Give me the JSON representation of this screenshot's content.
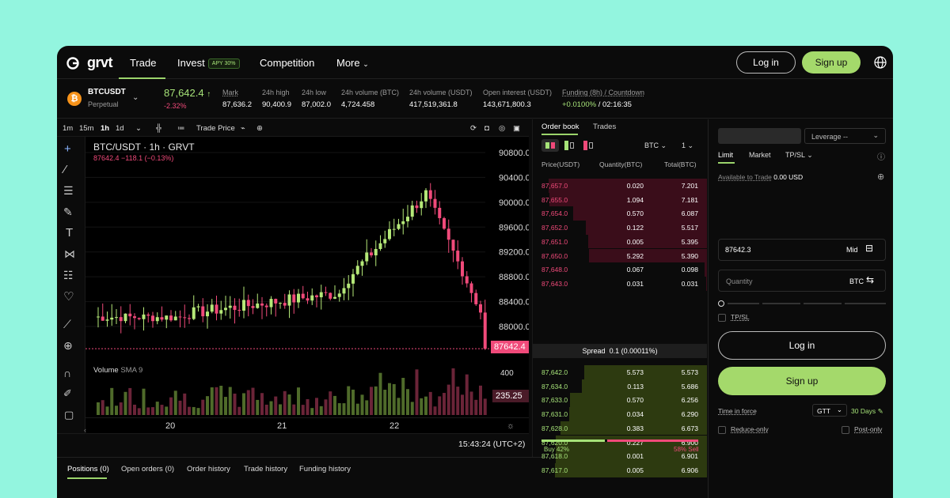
{
  "nav": {
    "logo_text": "grvt",
    "items": [
      {
        "label": "Trade"
      },
      {
        "label": "Invest"
      },
      {
        "label": "Competition"
      },
      {
        "label": "More"
      }
    ],
    "apy_badge": "APY 30%",
    "login": "Log in",
    "signup": "Sign up"
  },
  "ticker": {
    "symbol": "BTCUSDT",
    "type": "Perpetual",
    "price": "87,642.4",
    "change": "-2.32%",
    "stats": [
      {
        "label": "Mark",
        "value": "87,636.2"
      },
      {
        "label": "24h high",
        "value": "90,400.9"
      },
      {
        "label": "24h low",
        "value": "87,002.0"
      },
      {
        "label": "24h volume (BTC)",
        "value": "4,724.458"
      },
      {
        "label": "24h volume (USDT)",
        "value": "417,519,361.8"
      },
      {
        "label": "Open interest (USDT)",
        "value": "143,671,800.3"
      }
    ],
    "funding_label": "Funding (8h) / Countdown",
    "funding_rate": "+0.0100%",
    "funding_countdown": "/ 02:16:35"
  },
  "chart": {
    "intervals": [
      "1m",
      "15m",
      "1h",
      "1d"
    ],
    "active_interval": "1h",
    "trade_price_label": "Trade Price",
    "title": "BTC/USDT · 1h · GRVT",
    "ohlc_line": "87642.4  −118.1 (−0.13%)",
    "price_ticks": [
      "90800.0",
      "90400.0",
      "90000.0",
      "89600.0",
      "89200.0",
      "88800.0",
      "88400.0",
      "88000.0"
    ],
    "current_price_tag": "87642.4",
    "volume_label": "Volume",
    "sma_label": "SMA 9",
    "volume_tick": "400",
    "volume_value_tag": "235.25",
    "date_ticks": [
      "20",
      "21",
      "22"
    ],
    "clock": "15:43:24 (UTC+2)",
    "colors": {
      "up": "#b5e878",
      "down": "#f04a7a"
    }
  },
  "bottom_tabs": [
    "Positions (0)",
    "Open orders (0)",
    "Order history",
    "Trade history",
    "Funding history"
  ],
  "orderbook": {
    "tabs": [
      "Order book",
      "Trades"
    ],
    "unit": "BTC",
    "grouping": "1",
    "headers": [
      "Price(USDT)",
      "Quantity(BTC)",
      "Total(BTC)"
    ],
    "asks": [
      {
        "price": "87,657.0",
        "qty": "0.020",
        "total": "7.201"
      },
      {
        "price": "87,655.0",
        "qty": "1.094",
        "total": "7.181"
      },
      {
        "price": "87,654.0",
        "qty": "0.570",
        "total": "6.087"
      },
      {
        "price": "87,652.0",
        "qty": "0.122",
        "total": "5.517"
      },
      {
        "price": "87,651.0",
        "qty": "0.005",
        "total": "5.395"
      },
      {
        "price": "87,650.0",
        "qty": "5.292",
        "total": "5.390"
      },
      {
        "price": "87,648.0",
        "qty": "0.067",
        "total": "0.098"
      },
      {
        "price": "87,643.0",
        "qty": "0.031",
        "total": "0.031"
      }
    ],
    "spread_label": "Spread",
    "spread_value": "0.1 (0.00011%)",
    "bids": [
      {
        "price": "87,642.0",
        "qty": "5.573",
        "total": "5.573"
      },
      {
        "price": "87,634.0",
        "qty": "0.113",
        "total": "5.686"
      },
      {
        "price": "87,633.0",
        "qty": "0.570",
        "total": "6.256"
      },
      {
        "price": "87,631.0",
        "qty": "0.034",
        "total": "6.290"
      },
      {
        "price": "87,628.0",
        "qty": "0.383",
        "total": "6.673"
      },
      {
        "price": "87,620.0",
        "qty": "0.227",
        "total": "6.900"
      },
      {
        "price": "87,618.0",
        "qty": "0.001",
        "total": "6.901"
      },
      {
        "price": "87,617.0",
        "qty": "0.005",
        "total": "6.906"
      }
    ],
    "buy_label": "Buy 42%",
    "sell_label": "58% Sell",
    "buy_ratio": 0.42
  },
  "order_form": {
    "leverage": "Leverage --",
    "types": [
      "Limit",
      "Market",
      "TP/SL"
    ],
    "available_label": "Available to Trade",
    "available_value": "0.00 USD",
    "price_value": "87642.3",
    "mid_label": "Mid",
    "quantity_placeholder": "Quantity",
    "quantity_unit": "BTC",
    "tpsl_label": "TP/SL",
    "login": "Log in",
    "signup": "Sign up",
    "tif_label": "Time in force",
    "tif_value": "GTT",
    "tif_days": "30 Days",
    "reduce_only": "Reduce-only",
    "post_only": "Post-only"
  }
}
